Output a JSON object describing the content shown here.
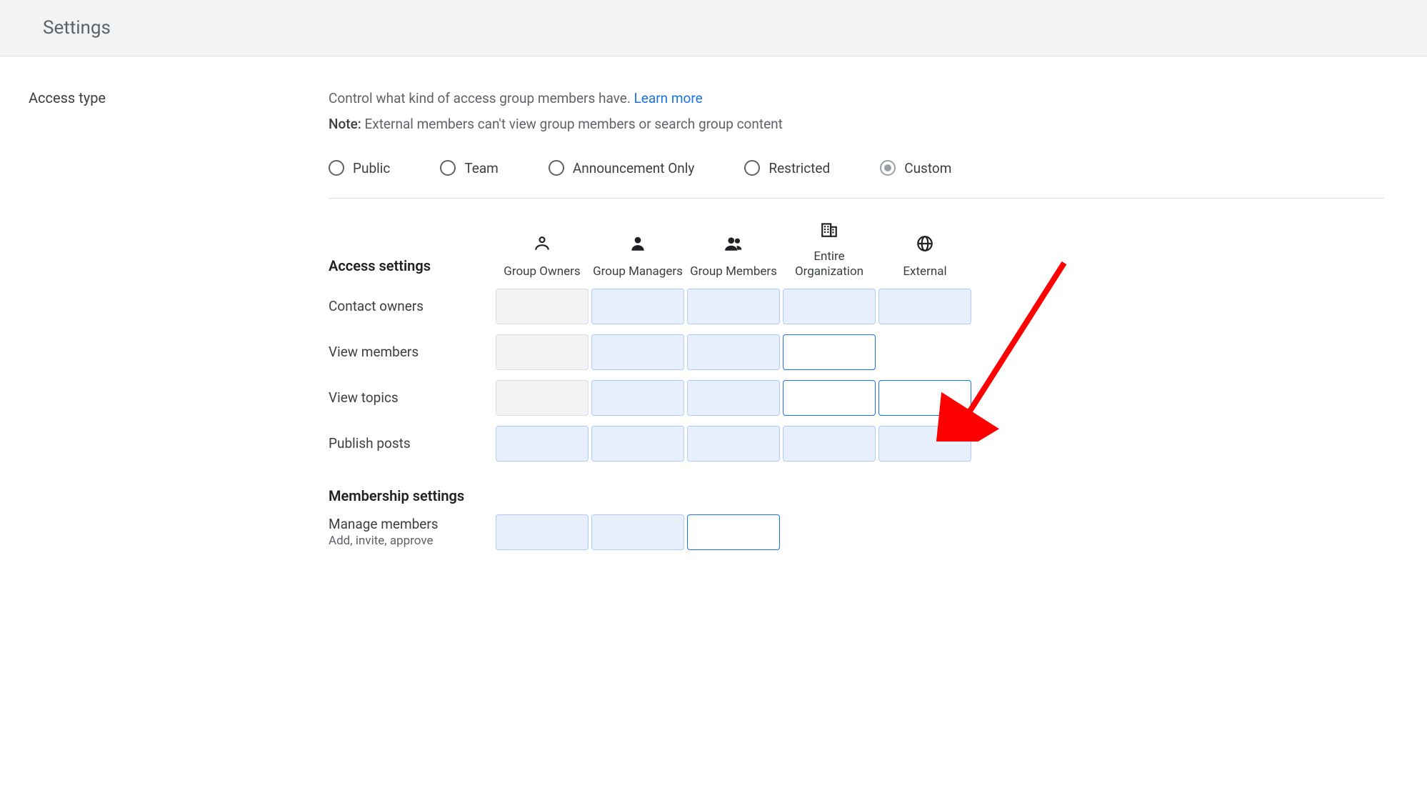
{
  "header": {
    "title": "Settings"
  },
  "section": {
    "label": "Access type"
  },
  "desc": {
    "lead": "Control what kind of access group members have.",
    "learn_more": "Learn more",
    "note_label": "Note:",
    "note_text": " External members can't view group members or search group content"
  },
  "radios": [
    {
      "id": "public",
      "label": "Public",
      "selected": false
    },
    {
      "id": "team",
      "label": "Team",
      "selected": false
    },
    {
      "id": "announcement",
      "label": "Announcement Only",
      "selected": false
    },
    {
      "id": "restricted",
      "label": "Restricted",
      "selected": false
    },
    {
      "id": "custom",
      "label": "Custom",
      "selected": true
    }
  ],
  "columns": [
    {
      "id": "owners",
      "label": "Group Owners",
      "icon": "person-outline-icon"
    },
    {
      "id": "managers",
      "label": "Group Managers",
      "icon": "person-icon"
    },
    {
      "id": "members",
      "label": "Group Members",
      "icon": "people-icon"
    },
    {
      "id": "org",
      "label": "Entire Organization",
      "icon": "building-icon"
    },
    {
      "id": "external",
      "label": "External",
      "icon": "globe-icon"
    }
  ],
  "sections": {
    "access_title": "Access settings",
    "membership_title": "Membership settings"
  },
  "rows_access": [
    {
      "label": "Contact owners",
      "cells": [
        "locked",
        "on",
        "on",
        "on",
        "on"
      ]
    },
    {
      "label": "View members",
      "cells": [
        "locked",
        "on",
        "on",
        "off",
        "none"
      ]
    },
    {
      "label": "View topics",
      "cells": [
        "locked",
        "on",
        "on",
        "off",
        "off"
      ]
    },
    {
      "label": "Publish posts",
      "cells": [
        "on",
        "on",
        "on",
        "on",
        "on"
      ]
    }
  ],
  "rows_membership": [
    {
      "label": "Manage members",
      "sub": "Add, invite, approve",
      "cells": [
        "on",
        "on",
        "off",
        "none",
        "none"
      ]
    }
  ]
}
